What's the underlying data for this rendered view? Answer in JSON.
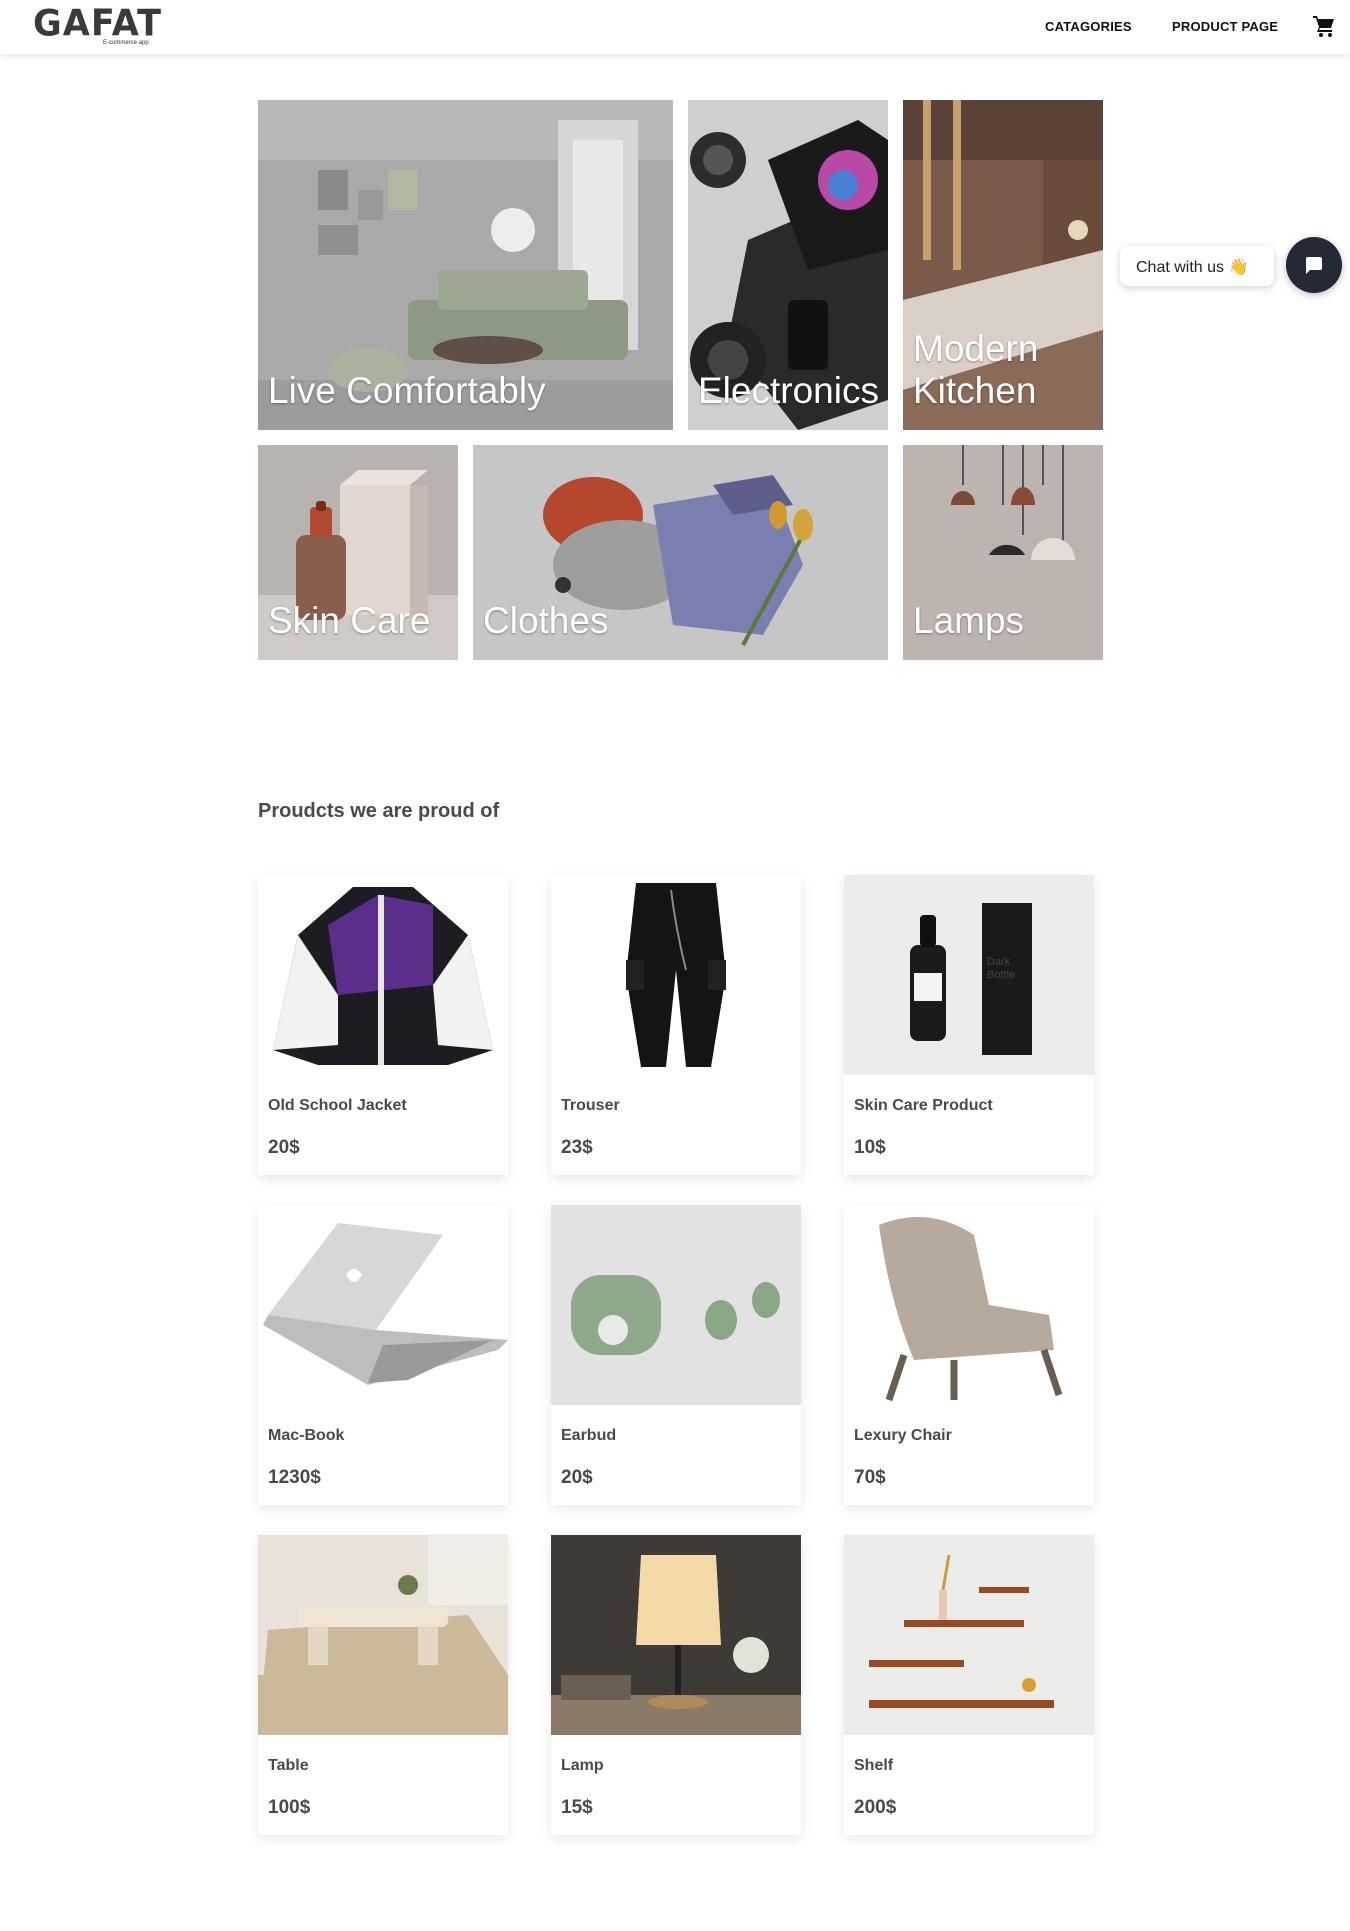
{
  "header": {
    "logo": "GAFAT",
    "logo_sub": "E-commerce app",
    "nav": [
      "CATAGORIES",
      "PRODUCT PAGE"
    ],
    "cart_icon": "cart-icon"
  },
  "categories": [
    {
      "label": "Live Comfortably"
    },
    {
      "label": "Electronics"
    },
    {
      "label": "Modern Kitchen"
    },
    {
      "label": "Skin Care"
    },
    {
      "label": "Clothes"
    },
    {
      "label": "Lamps"
    }
  ],
  "chat": {
    "label": "Chat with us",
    "emoji": "👋",
    "icon": "chat-icon"
  },
  "section_title": "Proudcts we are proud of",
  "products": [
    {
      "name": "Old School Jacket",
      "price": "20$"
    },
    {
      "name": "Trouser",
      "price": "23$"
    },
    {
      "name": "Skin Care Product",
      "price": "10$"
    },
    {
      "name": "Mac-Book",
      "price": "1230$"
    },
    {
      "name": "Earbud",
      "price": "20$"
    },
    {
      "name": "Lexury Chair",
      "price": "70$"
    },
    {
      "name": "Table",
      "price": "100$"
    },
    {
      "name": "Lamp",
      "price": "15$"
    },
    {
      "name": "Shelf",
      "price": "200$"
    }
  ]
}
